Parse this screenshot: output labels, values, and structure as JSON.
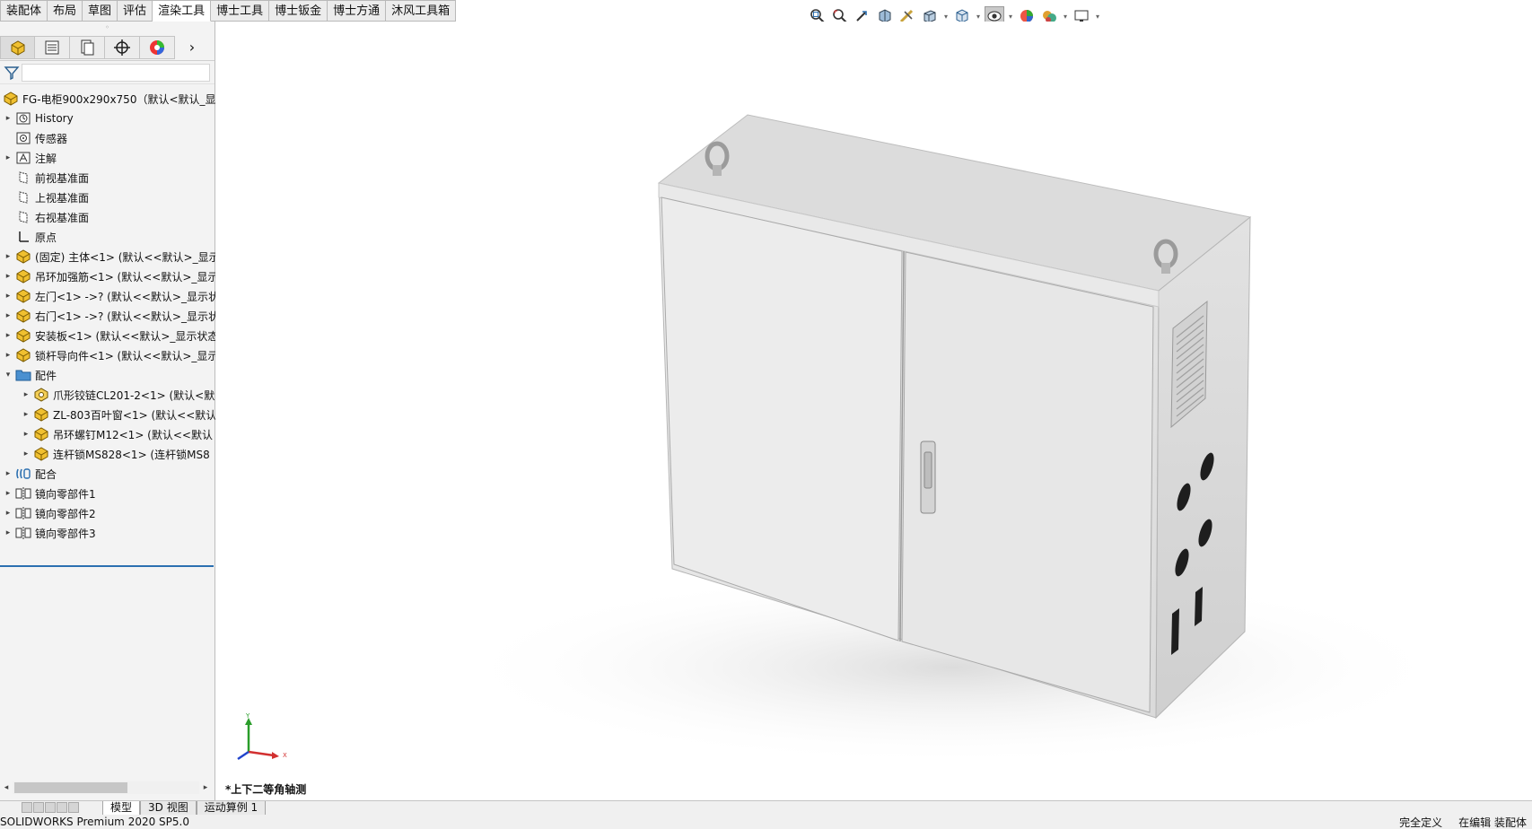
{
  "command_tabs": [
    {
      "label": "装配体",
      "active": false
    },
    {
      "label": "布局",
      "active": false
    },
    {
      "label": "草图",
      "active": false
    },
    {
      "label": "评估",
      "active": false
    },
    {
      "label": "渲染工具",
      "active": true
    },
    {
      "label": "博士工具",
      "active": false
    },
    {
      "label": "博士钣金",
      "active": false
    },
    {
      "label": "博士方通",
      "active": false
    },
    {
      "label": "沐风工具箱",
      "active": false
    }
  ],
  "hud_icons": [
    "zoom-to-fit-icon",
    "zoom-to-area-icon",
    "previous-view-icon",
    "section-view-icon",
    "dynamic-annotation-icon",
    "view-orientation-icon",
    "display-style-icon",
    "hide-show-items-icon",
    "edit-appearance-icon",
    "apply-scene-icon",
    "view-settings-icon"
  ],
  "panel_tabs": [
    "featuremanager-icon",
    "propertymanager-icon",
    "configurationmanager-icon",
    "dimxpert-icon",
    "display-manager-icon"
  ],
  "tree": {
    "root": "FG-电柜900x290x750（默认<默认_显示",
    "items": [
      {
        "label": "History",
        "icon": "history-icon",
        "expander": "▸",
        "indent": 1
      },
      {
        "label": "传感器",
        "icon": "sensor-icon",
        "expander": "",
        "indent": 1
      },
      {
        "label": "注解",
        "icon": "annotation-icon",
        "expander": "▸",
        "indent": 1
      },
      {
        "label": "前视基准面",
        "icon": "plane-icon",
        "expander": "",
        "indent": 1
      },
      {
        "label": "上视基准面",
        "icon": "plane-icon",
        "expander": "",
        "indent": 1
      },
      {
        "label": "右视基准面",
        "icon": "plane-icon",
        "expander": "",
        "indent": 1
      },
      {
        "label": "原点",
        "icon": "origin-icon",
        "expander": "",
        "indent": 1
      },
      {
        "label": "(固定) 主体<1> (默认<<默认>_显示",
        "icon": "assembly-icon",
        "expander": "▸",
        "indent": 1
      },
      {
        "label": "吊环加强筋<1> (默认<<默认>_显示",
        "icon": "assembly-icon",
        "expander": "▸",
        "indent": 1
      },
      {
        "label": "左门<1> ->? (默认<<默认>_显示状",
        "icon": "assembly-icon",
        "expander": "▸",
        "indent": 1
      },
      {
        "label": "右门<1> ->? (默认<<默认>_显示状",
        "icon": "assembly-icon",
        "expander": "▸",
        "indent": 1
      },
      {
        "label": "安装板<1> (默认<<默认>_显示状态",
        "icon": "assembly-icon",
        "expander": "▸",
        "indent": 1
      },
      {
        "label": "锁杆导向件<1> (默认<<默认>_显示",
        "icon": "assembly-icon",
        "expander": "▸",
        "indent": 1
      },
      {
        "label": "配件",
        "icon": "folder-icon",
        "expander": "▾",
        "indent": 1
      },
      {
        "label": "爪形铰链CL201-2<1> (默认<默",
        "icon": "part-icon",
        "expander": "▸",
        "indent": 2
      },
      {
        "label": "ZL-803百叶窗<1> (默认<<默认",
        "icon": "assembly-icon",
        "expander": "▸",
        "indent": 2
      },
      {
        "label": "吊环螺钉M12<1> (默认<<默认",
        "icon": "assembly-icon",
        "expander": "▸",
        "indent": 2
      },
      {
        "label": "连杆锁MS828<1> (连杆锁MS8",
        "icon": "assembly-icon",
        "expander": "▸",
        "indent": 2
      },
      {
        "label": "配合",
        "icon": "mates-icon",
        "expander": "▸",
        "indent": 1
      },
      {
        "label": "镜向零部件1",
        "icon": "mirror-component-icon",
        "expander": "▸",
        "indent": 1
      },
      {
        "label": "镜向零部件2",
        "icon": "mirror-component-icon",
        "expander": "▸",
        "indent": 1
      },
      {
        "label": "镜向零部件3",
        "icon": "mirror-component-icon",
        "expander": "▸",
        "indent": 1
      }
    ]
  },
  "viewport": {
    "view_name": "*上下二等角轴测",
    "triad": {
      "x": "X",
      "y": "Y"
    }
  },
  "bottom_tabs": [
    {
      "label": "模型",
      "active": true
    },
    {
      "label": "3D 视图",
      "active": false
    },
    {
      "label": "运动算例 1",
      "active": false
    }
  ],
  "status": {
    "product": "SOLIDWORKS Premium 2020 SP5.0",
    "definition": "完全定义",
    "editing": "在编辑 装配体"
  },
  "colors": {
    "accent": "#2b6fb0",
    "cabinet": "#e6e6e6"
  }
}
